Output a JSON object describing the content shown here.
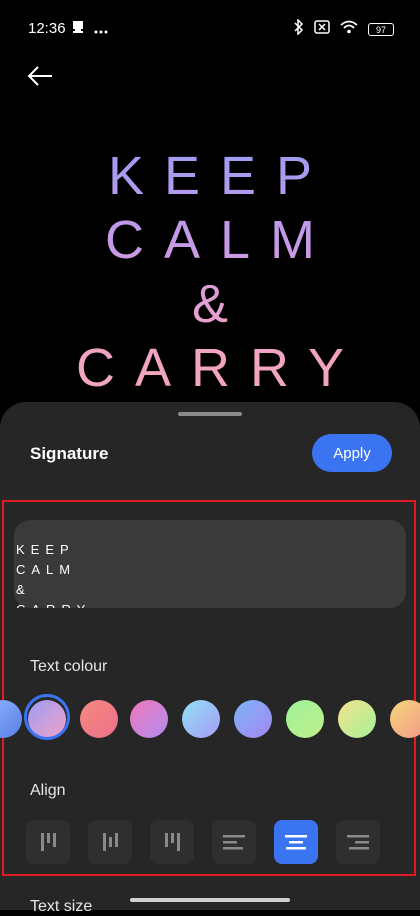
{
  "status_bar": {
    "time": "12:36",
    "left_icons": [
      "notification-icon",
      "more-icon"
    ],
    "right_icons": [
      "bluetooth-icon",
      "no-sim-icon",
      "wifi-icon"
    ],
    "battery": "97"
  },
  "preview": {
    "lines": [
      "KEEP",
      "CALM",
      "&",
      "CARRY"
    ],
    "gradient_colors": [
      "#9c9cf3",
      "#c79ae6",
      "#f0a2c8",
      "#f2a8b8"
    ]
  },
  "sheet": {
    "title": "Signature",
    "apply_label": "Apply",
    "input_text": "KEEP\nCALM\n&\nCARRY",
    "text_colour_label": "Text colour",
    "colours": [
      {
        "from": "#8fb5ff",
        "to": "#5a7fe6",
        "selected": false
      },
      {
        "from": "#9c9cf3",
        "to": "#f0a2c8",
        "selected": true
      },
      {
        "from": "#f58a7e",
        "to": "#ee6f8c",
        "selected": false
      },
      {
        "from": "#f078b8",
        "to": "#b18cf0",
        "selected": false
      },
      {
        "from": "#8fe0f5",
        "to": "#a89cf6",
        "selected": false
      },
      {
        "from": "#7fb4f7",
        "to": "#a387f2",
        "selected": false
      },
      {
        "from": "#9ef09a",
        "to": "#bff08a",
        "selected": false
      },
      {
        "from": "#f5e48a",
        "to": "#a3f09a",
        "selected": false
      },
      {
        "from": "#f5d57a",
        "to": "#f29a8a",
        "selected": false
      }
    ],
    "align_label": "Align",
    "align_options": [
      {
        "name": "vertical-left",
        "active": false
      },
      {
        "name": "vertical-center",
        "active": false
      },
      {
        "name": "vertical-right",
        "active": false
      },
      {
        "name": "left",
        "active": false
      },
      {
        "name": "center",
        "active": true
      },
      {
        "name": "right",
        "active": false
      }
    ],
    "text_size_label": "Text size"
  },
  "accent_color": "#3b74f0",
  "highlight_color": "#e11b22"
}
